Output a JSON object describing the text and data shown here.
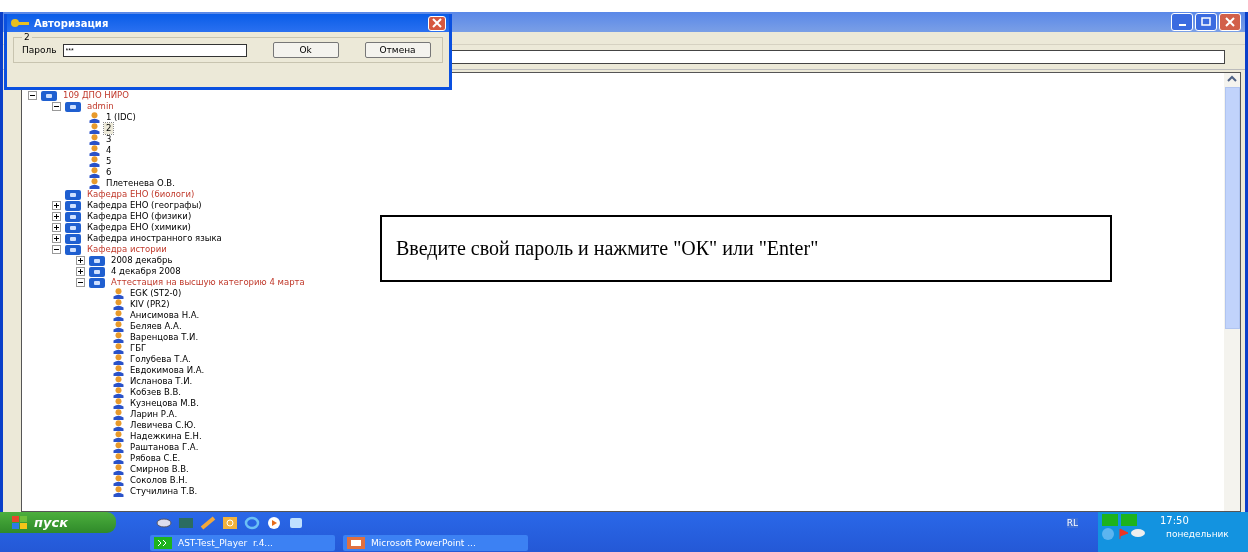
{
  "dialog": {
    "title": "Авторизация",
    "group_label": "2",
    "password_label": "Пароль",
    "password_value": "***",
    "buttons": [
      "Ok",
      "Отмена"
    ]
  },
  "callout": {
    "text": "Введите свой пароль и нажмите \"ОК\" или \"Enter\""
  },
  "tree": [
    {
      "kind": "group",
      "label": "109 ДПО НИРО",
      "red": true,
      "selected": false,
      "expanded": true,
      "children": [
        {
          "kind": "group",
          "label": "admin",
          "red": true,
          "selected": false,
          "expanded": true,
          "children": [
            {
              "kind": "user",
              "label": "1 (IDC)",
              "red": false,
              "selected": false
            },
            {
              "kind": "user",
              "label": "2",
              "red": false,
              "selected": true
            },
            {
              "kind": "user",
              "label": "3",
              "red": false,
              "selected": false
            },
            {
              "kind": "user",
              "label": "4",
              "red": false,
              "selected": false
            },
            {
              "kind": "user",
              "label": "5",
              "red": false,
              "selected": false
            },
            {
              "kind": "user",
              "label": "6",
              "red": false,
              "selected": false
            },
            {
              "kind": "user",
              "label": "Плетенева О.В.",
              "red": false,
              "selected": false
            }
          ]
        },
        {
          "kind": "group",
          "label": "Кафедра ЕНО (биологи)",
          "red": true,
          "selected": false
        },
        {
          "kind": "group",
          "label": "Кафедра ЕНО (географы)",
          "red": false,
          "selected": false,
          "expanded": false
        },
        {
          "kind": "group",
          "label": "Кафедра ЕНО (физики)",
          "red": false,
          "selected": false,
          "expanded": false
        },
        {
          "kind": "group",
          "label": "Кафедра ЕНО (химики)",
          "red": false,
          "selected": false,
          "expanded": false
        },
        {
          "kind": "group",
          "label": "Кафедра иностранного языка",
          "red": false,
          "selected": false,
          "expanded": false
        },
        {
          "kind": "group",
          "label": "Кафедра истории",
          "red": true,
          "selected": false,
          "expanded": true,
          "children": [
            {
              "kind": "group",
              "label": "2008 декабрь",
              "red": false,
              "selected": false,
              "expanded": false
            },
            {
              "kind": "group",
              "label": "4 декабря 2008",
              "red": false,
              "selected": false,
              "expanded": false
            },
            {
              "kind": "group",
              "label": "Аттестация на высшую категорию 4 марта",
              "red": true,
              "selected": false,
              "expanded": true,
              "children": [
                {
                  "kind": "user",
                  "label": "EGK (ST2-0)",
                  "red": false,
                  "selected": false
                },
                {
                  "kind": "user",
                  "label": "KIV (PR2)",
                  "red": false,
                  "selected": false
                },
                {
                  "kind": "user",
                  "label": "Анисимова Н.А.",
                  "red": false,
                  "selected": false
                },
                {
                  "kind": "user",
                  "label": "Беляев А.А.",
                  "red": false,
                  "selected": false
                },
                {
                  "kind": "user",
                  "label": "Варенцова Т.И.",
                  "red": false,
                  "selected": false
                },
                {
                  "kind": "user",
                  "label": "ГБГ",
                  "red": false,
                  "selected": false
                },
                {
                  "kind": "user",
                  "label": "Голубева Т.А.",
                  "red": false,
                  "selected": false
                },
                {
                  "kind": "user",
                  "label": "Евдокимова И.А.",
                  "red": false,
                  "selected": false
                },
                {
                  "kind": "user",
                  "label": "Исланова Т.И.",
                  "red": false,
                  "selected": false
                },
                {
                  "kind": "user",
                  "label": "Кобзев В.В.",
                  "red": false,
                  "selected": false
                },
                {
                  "kind": "user",
                  "label": "Кузнецова М.В.",
                  "red": false,
                  "selected": false
                },
                {
                  "kind": "user",
                  "label": "Ларин Р.А.",
                  "red": false,
                  "selected": false
                },
                {
                  "kind": "user",
                  "label": "Левичева С.Ю.",
                  "red": false,
                  "selected": false
                },
                {
                  "kind": "user",
                  "label": "Надежкина Е.Н.",
                  "red": false,
                  "selected": false
                },
                {
                  "kind": "user",
                  "label": "Раштанова Г.А.",
                  "red": false,
                  "selected": false
                },
                {
                  "kind": "user",
                  "label": "Рябова С.Е.",
                  "red": false,
                  "selected": false
                },
                {
                  "kind": "user",
                  "label": "Смирнов В.В.",
                  "red": false,
                  "selected": false
                },
                {
                  "kind": "user",
                  "label": "Соколов В.Н.",
                  "red": false,
                  "selected": false
                },
                {
                  "kind": "user",
                  "label": "Стучилина Т.В.",
                  "red": false,
                  "selected": false
                }
              ]
            }
          ]
        }
      ]
    }
  ],
  "taskbar": {
    "start_label": "пуск",
    "tasks": [
      {
        "label": "AST-Test_Player  r.4...",
        "kind": "player",
        "selected": false
      },
      {
        "label": "Microsoft PowerPoint ...",
        "kind": "powerpoint",
        "selected": false
      }
    ],
    "language": "RL",
    "time": "17:50",
    "day": "понедельник"
  }
}
